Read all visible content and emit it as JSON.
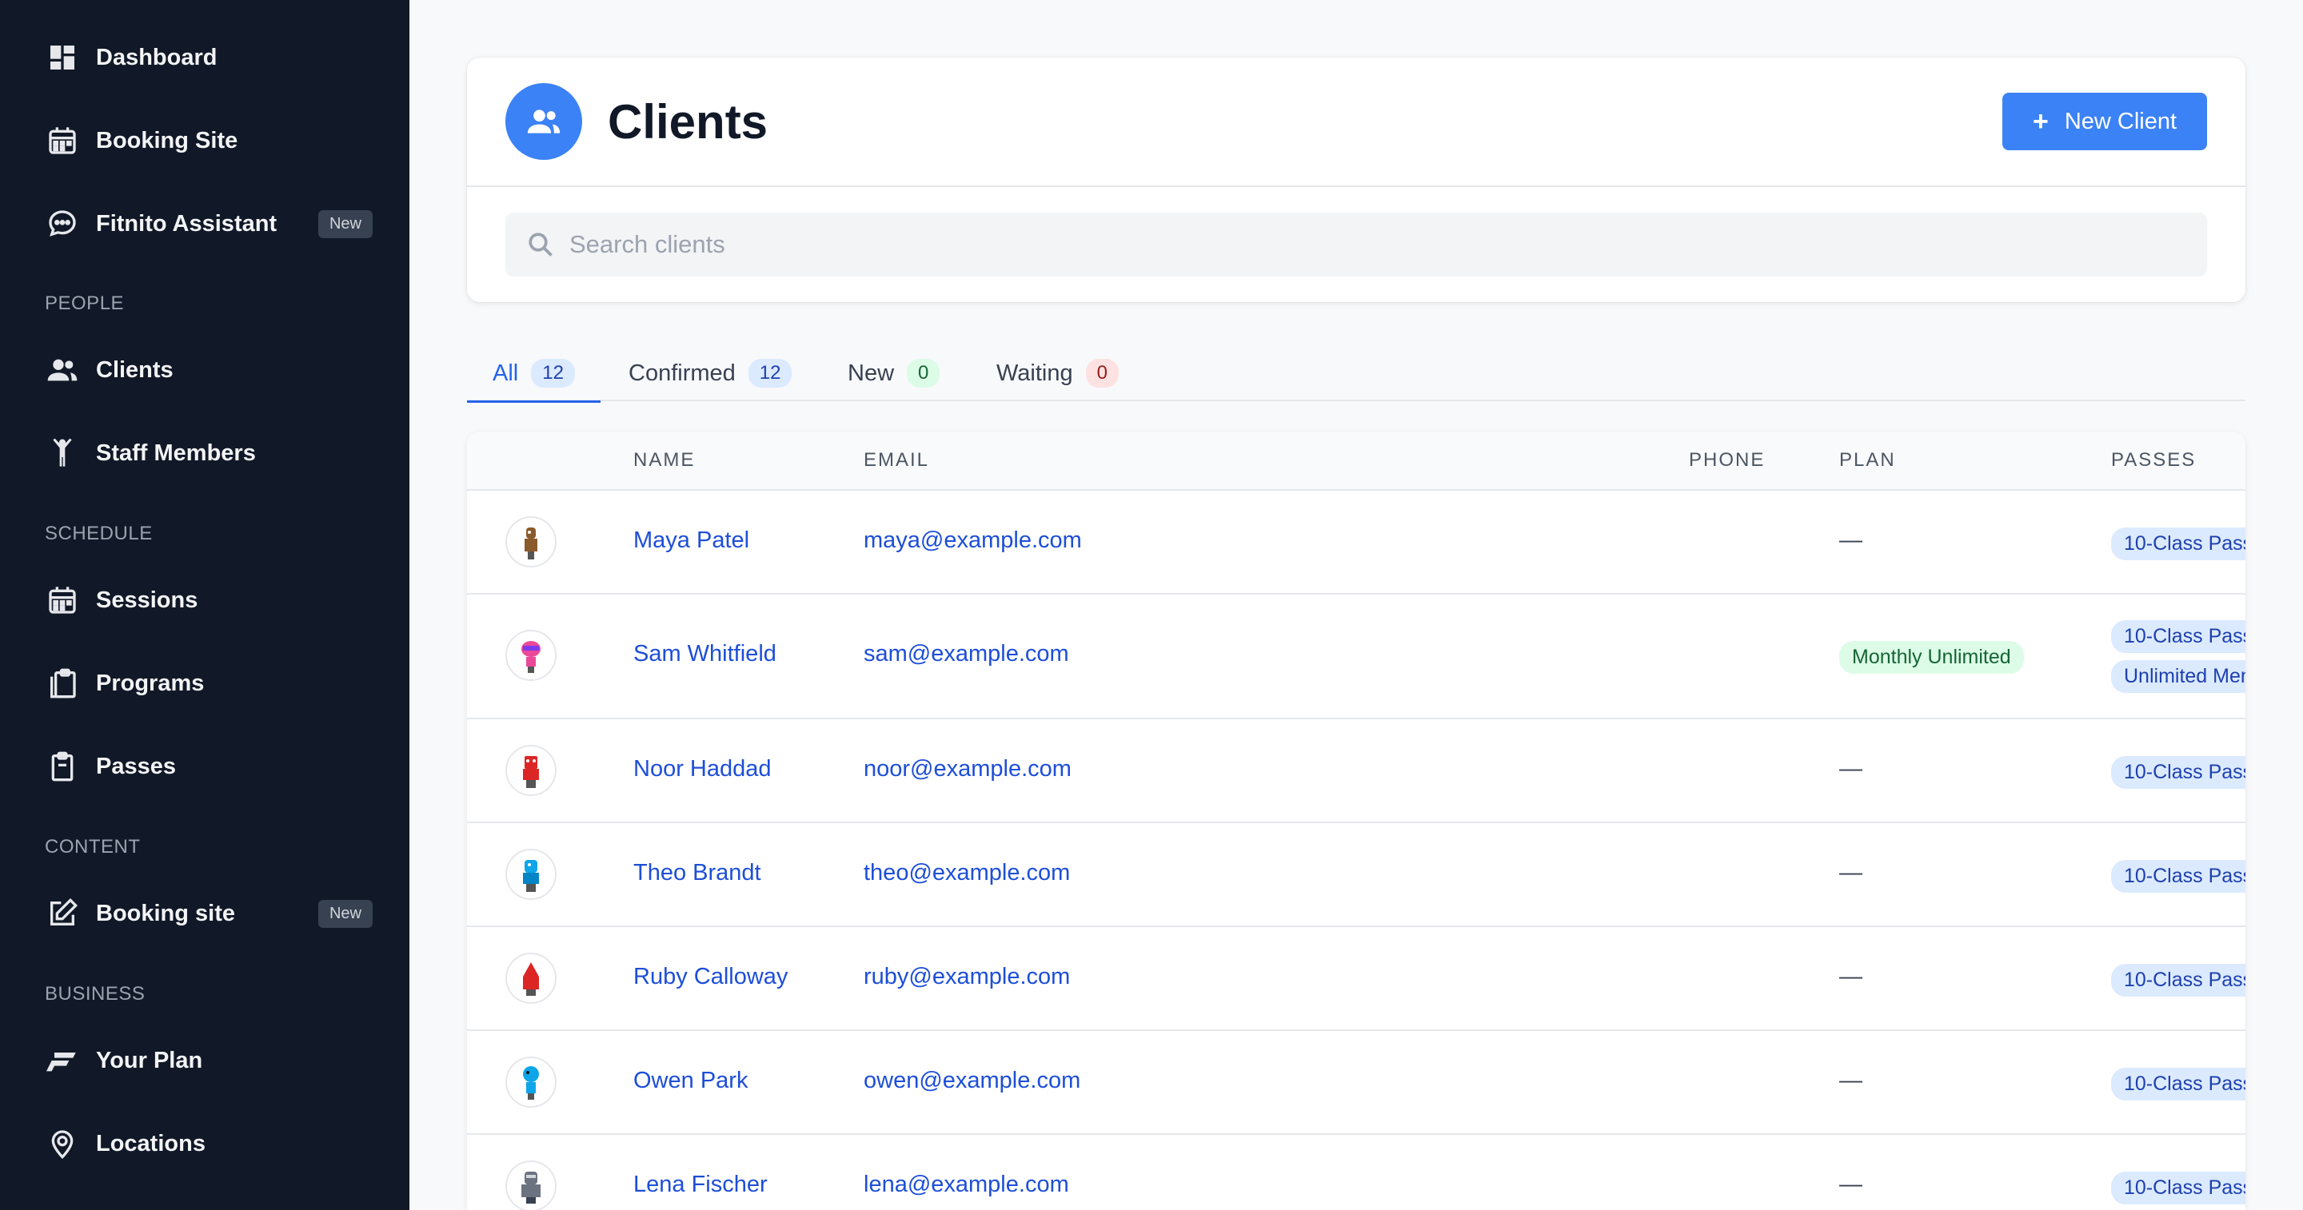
{
  "sidebar": {
    "top_items": [
      {
        "label": "Dashboard",
        "icon": "dashboard-icon"
      },
      {
        "label": "Booking Site",
        "icon": "calendar-icon"
      },
      {
        "label": "Fitnito Assistant",
        "icon": "chat-bubble-icon",
        "badge": "New"
      }
    ],
    "sections": [
      {
        "label": "PEOPLE",
        "items": [
          {
            "label": "Clients",
            "icon": "people-icon"
          },
          {
            "label": "Staff Members",
            "icon": "staff-figure-icon"
          }
        ]
      },
      {
        "label": "SCHEDULE",
        "items": [
          {
            "label": "Sessions",
            "icon": "calendar-icon"
          },
          {
            "label": "Programs",
            "icon": "clipboard-stack-icon"
          },
          {
            "label": "Passes",
            "icon": "clipboard-icon"
          }
        ]
      },
      {
        "label": "CONTENT",
        "items": [
          {
            "label": "Booking site",
            "icon": "edit-icon",
            "badge": "New"
          }
        ]
      },
      {
        "label": "BUSINESS",
        "items": [
          {
            "label": "Your Plan",
            "icon": "fitnito-logo-icon"
          },
          {
            "label": "Locations",
            "icon": "location-pin-icon"
          }
        ]
      }
    ]
  },
  "header": {
    "title": "Clients",
    "new_button_label": "New Client",
    "new_button_icon": "+",
    "search_placeholder": "Search clients",
    "search_value": ""
  },
  "tabs": [
    {
      "label": "All",
      "count": "12"
    },
    {
      "label": "Confirmed",
      "count": "12"
    },
    {
      "label": "New",
      "count": "0"
    },
    {
      "label": "Waiting",
      "count": "0"
    }
  ],
  "table": {
    "columns": [
      "NAME",
      "EMAIL",
      "PHONE",
      "PLAN",
      "PASSES"
    ],
    "rows": [
      {
        "name": "Maya Patel",
        "email": "maya@example.com",
        "plan": "—",
        "passes": [
          "10-Class Pass"
        ],
        "avatar_color": "#8b5a2b"
      },
      {
        "name": "Sam Whitfield",
        "email": "sam@example.com",
        "plan": "Monthly Unlimited",
        "passes": [
          "10-Class Pass",
          "Unlimited Membership"
        ],
        "avatar_color": "#ec4899"
      },
      {
        "name": "Noor Haddad",
        "email": "noor@example.com",
        "plan": "—",
        "passes": [
          "10-Class Pass"
        ],
        "avatar_color": "#dc2626"
      },
      {
        "name": "Theo Brandt",
        "email": "theo@example.com",
        "plan": "—",
        "passes": [
          "10-Class Pass"
        ],
        "avatar_color": "#0ea5e9"
      },
      {
        "name": "Ruby Calloway",
        "email": "ruby@example.com",
        "plan": "—",
        "passes": [
          "10-Class Pass"
        ],
        "avatar_color": "#dc2626"
      },
      {
        "name": "Owen Park",
        "email": "owen@example.com",
        "plan": "—",
        "passes": [
          "10-Class Pass"
        ],
        "avatar_color": "#0ea5e9"
      },
      {
        "name": "Lena Fischer",
        "email": "lena@example.com",
        "plan": "—",
        "passes": [
          "10-Class Pass"
        ],
        "avatar_color": "#6b7280"
      }
    ]
  },
  "colors": {
    "sidebar_bg": "#111827",
    "accent": "#3b82f6",
    "link": "#1d4ed8",
    "success_badge_bg": "#dcfce7",
    "pass_badge_bg": "#dbeafe",
    "tab_count_blue": "#dbeafe",
    "tab_count_green": "#dcfce7",
    "tab_count_red": "#fee2e2"
  }
}
